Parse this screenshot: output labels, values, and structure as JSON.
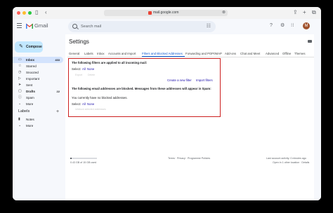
{
  "browser": {
    "url": "mail.google.com",
    "icons": [
      "sidebar-icon",
      "back-icon",
      "share-icon",
      "new-tab-icon",
      "tabs-overview-icon"
    ]
  },
  "header": {
    "app_name": "Gmail",
    "search_placeholder": "Search mail",
    "avatar_initial": "M"
  },
  "sidebar": {
    "compose_label": "Compose",
    "items": [
      {
        "label": "Inbox",
        "count": "433",
        "icon": "inbox-icon",
        "bold": true,
        "active": true
      },
      {
        "label": "Starred",
        "count": "",
        "icon": "star-icon",
        "bold": false,
        "active": false
      },
      {
        "label": "Snoozed",
        "count": "",
        "icon": "clock-icon",
        "bold": false,
        "active": false
      },
      {
        "label": "Important",
        "count": "",
        "icon": "important-icon",
        "bold": false,
        "active": false
      },
      {
        "label": "Sent",
        "count": "",
        "icon": "send-icon",
        "bold": false,
        "active": false
      },
      {
        "label": "Drafts",
        "count": "22",
        "icon": "draft-icon",
        "bold": true,
        "active": false
      },
      {
        "label": "Spam",
        "count": "",
        "icon": "spam-icon",
        "bold": false,
        "active": false
      },
      {
        "label": "More",
        "count": "",
        "icon": "chevron-down-icon",
        "bold": false,
        "active": false
      }
    ],
    "labels_title": "Labels",
    "label_items": [
      {
        "label": "Notes",
        "icon": "label-icon"
      },
      {
        "label": "More",
        "icon": "chevron-down-icon"
      }
    ]
  },
  "main": {
    "title": "Settings",
    "tabs": [
      "General",
      "Labels",
      "Inbox",
      "Accounts and Import",
      "Filters and Blocked Addresses",
      "Forwarding and POP/IMAP",
      "Add-ons",
      "Chat and Meet",
      "Advanced",
      "Offline",
      "Themes"
    ],
    "selected_tab": "Filters and Blocked Addresses",
    "filters": {
      "heading": "The following filters are applied to all incoming mail:",
      "select_label": "Select:",
      "select_all": "All",
      "select_none": "None",
      "export_label": "Export",
      "delete_label": "Delete",
      "create_filter": "Create a new filter",
      "import_filters": "Import filters"
    },
    "blocked": {
      "heading": "The following email addresses are blocked. Messages from these addresses will appear in Spam:",
      "empty_text": "You currently have no blocked addresses.",
      "select_label": "Select:",
      "select_all": "All",
      "select_none": "None",
      "unblock_label": "Unblock selected addresses"
    },
    "footer": {
      "storage": "0.43 GB of 15 GB used",
      "terms": "Terms",
      "privacy": "Privacy",
      "policies": "Programme Policies",
      "activity": "Last account activity: 0 minutes ago",
      "location": "Open in 1 other location · Details"
    }
  },
  "colors": {
    "accent": "#0b57d0",
    "highlight_border": "#cc1f1f",
    "compose_bg": "#c2e7ff",
    "active_nav": "#d3e3fd"
  }
}
